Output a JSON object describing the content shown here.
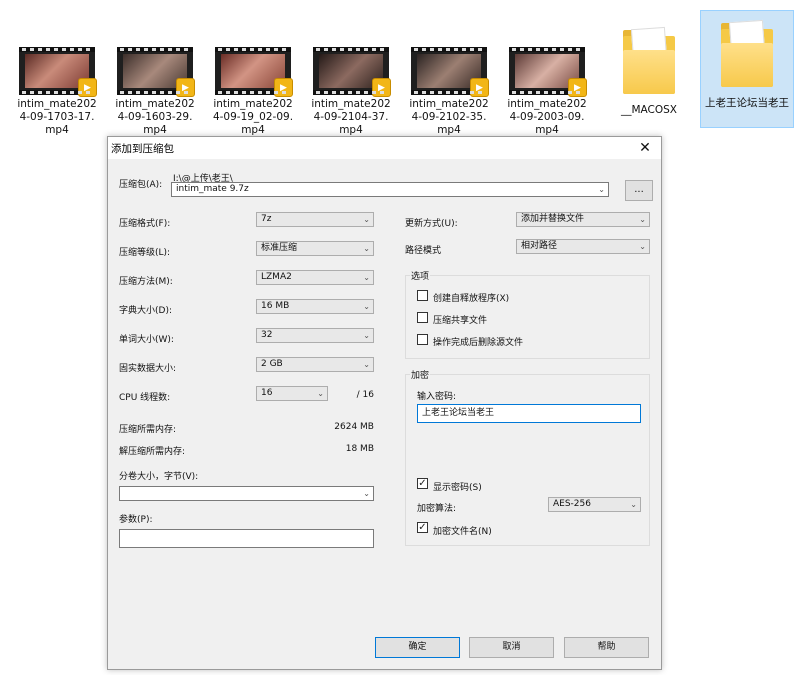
{
  "desktop": {
    "videos": [
      {
        "label": "intim_mate2024-09-1703-17.mp4"
      },
      {
        "label": "intim_mate2024-09-1603-29.mp4"
      },
      {
        "label": "intim_mate2024-09-19_02-09.mp4"
      },
      {
        "label": "intim_mate2024-09-2104-37.mp4"
      },
      {
        "label": "intim_mate2024-09-2102-35.mp4"
      },
      {
        "label": "intim_mate2024-09-2003-09.mp4"
      }
    ],
    "badge_text": "▶",
    "folders": [
      {
        "label": "__MACOSX"
      },
      {
        "label": "上老王论坛当老王"
      }
    ]
  },
  "dialog": {
    "title": "添加到压缩包",
    "close": "✕",
    "archive": {
      "label": "压缩包(A):",
      "path": "I:\\@上传\\老王\\",
      "value": "intim_mate 9.7z",
      "browse": "..."
    },
    "left": {
      "format": {
        "label": "压缩格式(F):",
        "value": "7z"
      },
      "level": {
        "label": "压缩等级(L):",
        "value": "标准压缩"
      },
      "method": {
        "label": "压缩方法(M):",
        "value": "LZMA2"
      },
      "dict": {
        "label": "字典大小(D):",
        "value": "16 MB"
      },
      "word": {
        "label": "单词大小(W):",
        "value": "32"
      },
      "solid": {
        "label": "固实数据大小:",
        "value": "2 GB"
      },
      "cpu": {
        "label": "CPU 线程数:",
        "value": "16",
        "total": "/ 16"
      },
      "mem_comp": {
        "label": "压缩所需内存:",
        "value": "2624 MB"
      },
      "mem_decomp": {
        "label": "解压缩所需内存:",
        "value": "18 MB"
      },
      "volume": {
        "label": "分卷大小，字节(V):",
        "value": ""
      },
      "params": {
        "label": "参数(P):",
        "value": ""
      }
    },
    "right": {
      "update": {
        "label": "更新方式(U):",
        "value": "添加并替换文件"
      },
      "pathmode": {
        "label": "路径模式",
        "value": "相对路径"
      },
      "options": {
        "title": "选项",
        "sfx": "创建自释放程序(X)",
        "shared": "压缩共享文件",
        "delete": "操作完成后删除源文件"
      },
      "encrypt": {
        "title": "加密",
        "pw_label": "输入密码:",
        "pw_value": "上老王论坛当老王",
        "show_pw": "显示密码(S)",
        "method_label": "加密算法:",
        "method_value": "AES-256",
        "enc_names": "加密文件名(N)"
      }
    },
    "buttons": {
      "ok": "确定",
      "cancel": "取消",
      "help": "帮助"
    },
    "arrow_glyph": "⌄"
  }
}
